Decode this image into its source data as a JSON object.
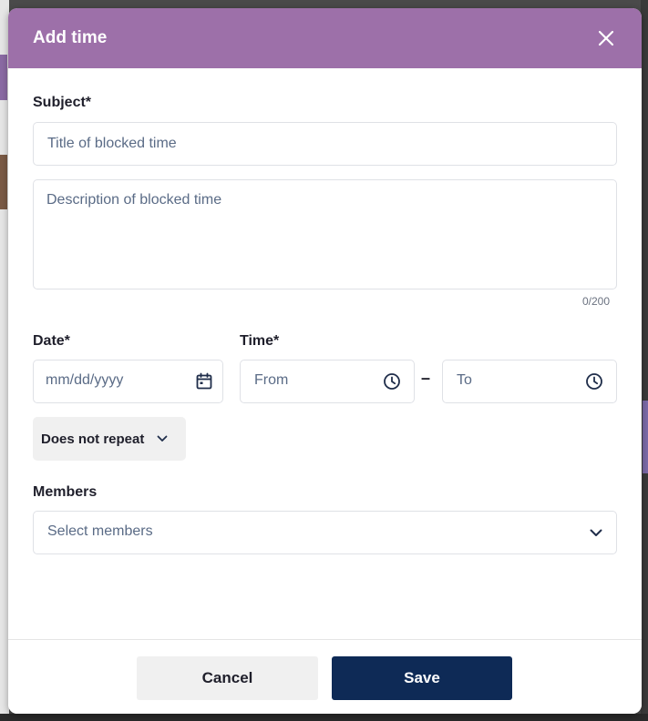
{
  "dialog": {
    "title": "Add time",
    "close_icon": "close-icon"
  },
  "subject": {
    "label": "Subject*",
    "title_placeholder": "Title of blocked time",
    "description_placeholder": "Description of blocked time",
    "counter": "0/200"
  },
  "date": {
    "label": "Date*",
    "placeholder": "mm/dd/yyyy",
    "icon": "calendar-icon"
  },
  "time": {
    "label": "Time*",
    "from_placeholder": "From",
    "to_placeholder": "To",
    "separator": "–",
    "icon": "clock-icon"
  },
  "repeat": {
    "selected": "Does not repeat",
    "icon": "chevron-down-icon"
  },
  "members": {
    "label": "Members",
    "placeholder": "Select members",
    "icon": "chevron-down-icon"
  },
  "footer": {
    "cancel_label": "Cancel",
    "save_label": "Save"
  },
  "colors": {
    "header": "#9d70a9",
    "primary_button": "#0e2a56",
    "secondary_button": "#f0f0f0",
    "placeholder_text": "#5a6b86"
  }
}
